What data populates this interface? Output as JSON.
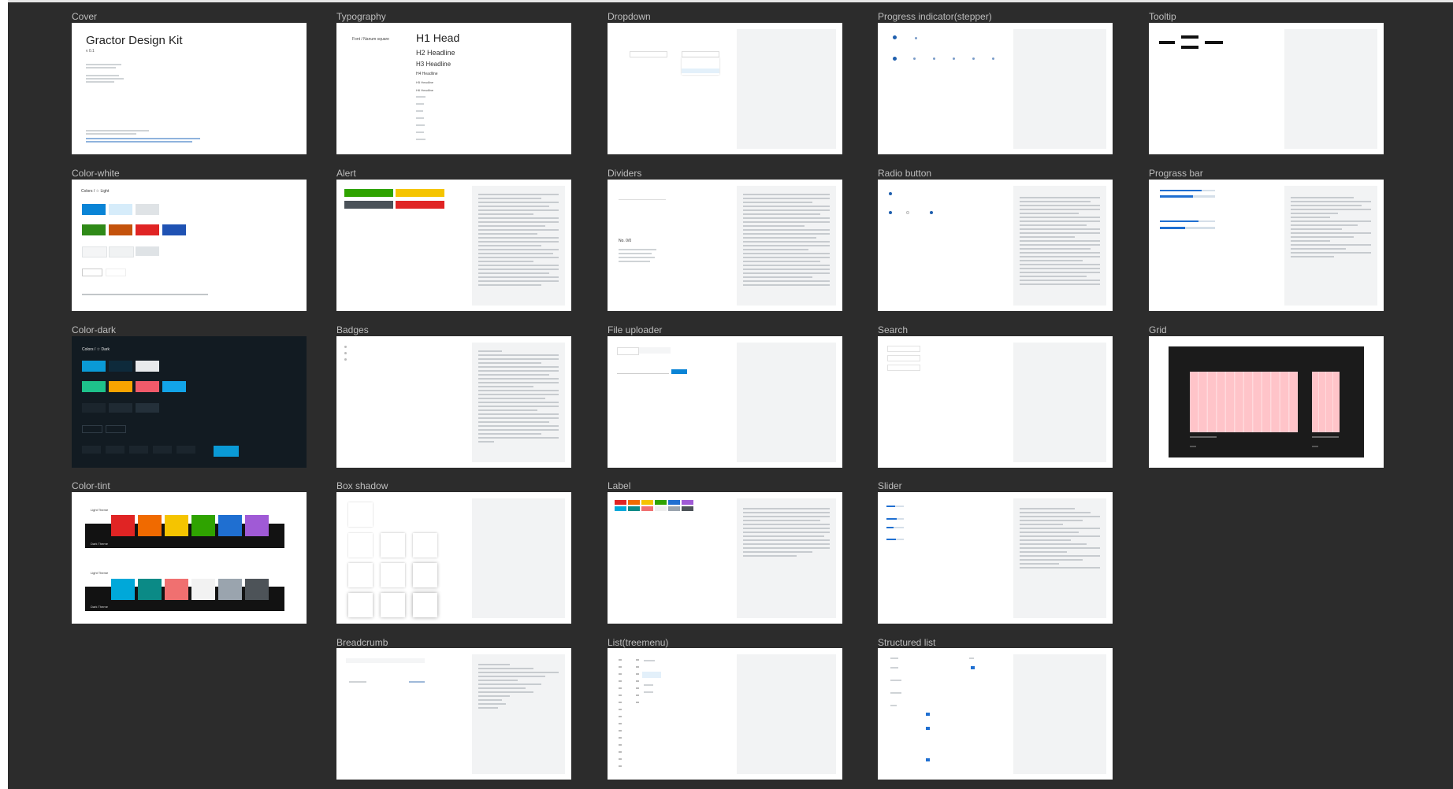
{
  "frames": [
    {
      "id": "cover",
      "label": "Cover"
    },
    {
      "id": "typography",
      "label": "Typography"
    },
    {
      "id": "dropdown",
      "label": "Dropdown"
    },
    {
      "id": "stepper",
      "label": "Progress indicator(stepper)"
    },
    {
      "id": "tooltip",
      "label": "Tooltip"
    },
    {
      "id": "color-white",
      "label": "Color-white"
    },
    {
      "id": "alert",
      "label": "Alert"
    },
    {
      "id": "dividers",
      "label": "Dividers"
    },
    {
      "id": "radio",
      "label": "Radio button"
    },
    {
      "id": "progress-bar",
      "label": "Prograss bar"
    },
    {
      "id": "color-dark",
      "label": "Color-dark"
    },
    {
      "id": "badges",
      "label": "Badges"
    },
    {
      "id": "file-uploader",
      "label": "File uploader"
    },
    {
      "id": "search",
      "label": "Search"
    },
    {
      "id": "grid",
      "label": "Grid"
    },
    {
      "id": "color-tint",
      "label": "Color-tint"
    },
    {
      "id": "box-shadow",
      "label": "Box shadow"
    },
    {
      "id": "label",
      "label": "Label"
    },
    {
      "id": "slider",
      "label": "Slider"
    },
    {
      "id": "breadcrumb",
      "label": "Breadcrumb"
    },
    {
      "id": "treemenu",
      "label": "List(treemenu)"
    },
    {
      "id": "structured-list",
      "label": "Structured list"
    }
  ],
  "cover": {
    "title": "Gractor Design Kit",
    "version": "v 0.1"
  },
  "typography": {
    "font_label": "Font / Nanum square",
    "h1": "H1 Head",
    "h2": "H2 Headline",
    "h3": "H3 Headline",
    "h4": "H4 Headline",
    "h5": "H5 Headline",
    "h6": "H6 Headline"
  },
  "color_white": {
    "title": "Colors / ☆ Light"
  },
  "color_dark": {
    "title": "Colors / ☆ Dark"
  },
  "color_tint": {
    "light_theme": "Light Theme",
    "dark_theme": "Dark Theme",
    "row1": [
      "Red",
      "Orange",
      "Yellow",
      "Green",
      "Blue",
      "Purple"
    ],
    "row2": [
      "Cyan",
      "Teal",
      "Coral",
      "Light",
      "Gray",
      "Dark"
    ]
  },
  "dividers": {
    "heading": "No. 0/0"
  },
  "colors": {
    "accent": "#0a84d6",
    "red": "#e02424",
    "orange": "#f06a00",
    "yellow": "#f5c400",
    "green": "#2fa300",
    "blue": "#1f6fd1",
    "purple": "#a05ad6",
    "cyan": "#00a8d9",
    "teal": "#0b8a86",
    "coral": "#f07070",
    "grid_pink": "#ffc4c9",
    "grid_bg": "#1b1b1b"
  }
}
